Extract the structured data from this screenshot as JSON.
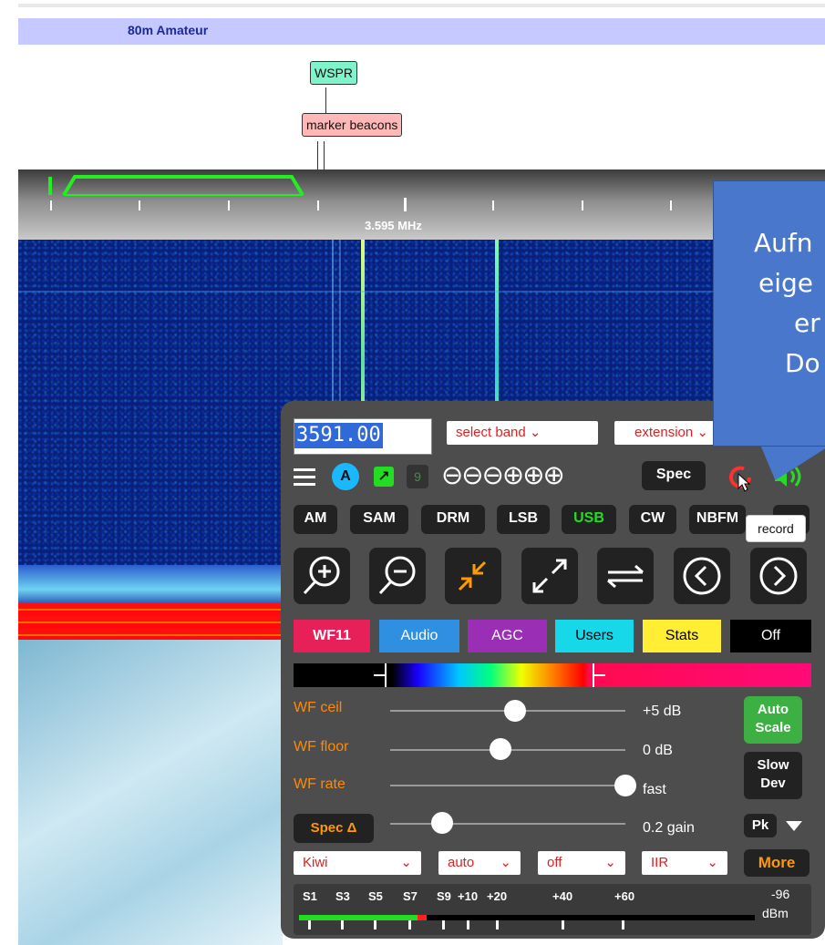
{
  "band": {
    "label": "80m Amateur"
  },
  "markers": {
    "wspr": "WSPR",
    "beacons": "marker beacons"
  },
  "scale": {
    "freq_label": "3.595 MHz"
  },
  "callout": {
    "line1": "Aufn",
    "line2": "eige",
    "line3": "er",
    "line4": "Do"
  },
  "controls": {
    "frequency": "3591.00",
    "select_band": "select band",
    "extension": "extension",
    "agc_badge": "A",
    "nine": "9",
    "zoom_glyphs": "⊖⊖⊖⊕⊕⊕",
    "spec_button": "Spec",
    "tooltip": "record",
    "modes": [
      "AM",
      "SAM",
      "DRM",
      "LSB",
      "USB",
      "CW",
      "NBFM"
    ],
    "active_mode": "USB"
  },
  "tabs": [
    {
      "label": "WF11",
      "bg": "#e8205a",
      "color": "#ffffff",
      "bold": true
    },
    {
      "label": "Audio",
      "bg": "#2f8fe0",
      "color": "#ffffff"
    },
    {
      "label": "AGC",
      "bg": "#9a2fb5",
      "color": "#ffffff"
    },
    {
      "label": "Users",
      "bg": "#17d8e8",
      "color": "#000000"
    },
    {
      "label": "Stats",
      "bg": "#ffee33",
      "color": "#000000"
    },
    {
      "label": "Off",
      "bg": "#000000",
      "color": "#ffffff"
    }
  ],
  "sliders": {
    "wf_ceil": {
      "label": "WF ceil",
      "value": "+5 dB",
      "level": 0.53
    },
    "wf_floor": {
      "label": "WF floor",
      "value": "0 dB",
      "level": 0.47
    },
    "wf_rate": {
      "label": "WF rate",
      "value": "fast",
      "level": 1.0
    },
    "spec_gain": {
      "label": "Spec Δ",
      "value": "0.2 gain",
      "level": 0.22
    }
  },
  "side_buttons": {
    "auto_scale_1": "Auto",
    "auto_scale_2": "Scale",
    "slow_dev_1": "Slow",
    "slow_dev_2": "Dev",
    "pk": "Pk"
  },
  "bottom_selects": {
    "kiwi": "Kiwi",
    "auto": "auto",
    "off": "off",
    "iir": "IIR",
    "more": "More"
  },
  "smeter": {
    "labels": [
      "S1",
      "S3",
      "S5",
      "S7",
      "S9",
      "+10",
      "+20",
      "+40",
      "+60"
    ],
    "dbm_value": "-96",
    "dbm_unit": "dBm",
    "level": 0.26
  },
  "colors": {
    "accent_green": "#22cc22",
    "active_mode": "#22dd22",
    "record": "#ff3030",
    "panel": "#4d4d4d"
  }
}
